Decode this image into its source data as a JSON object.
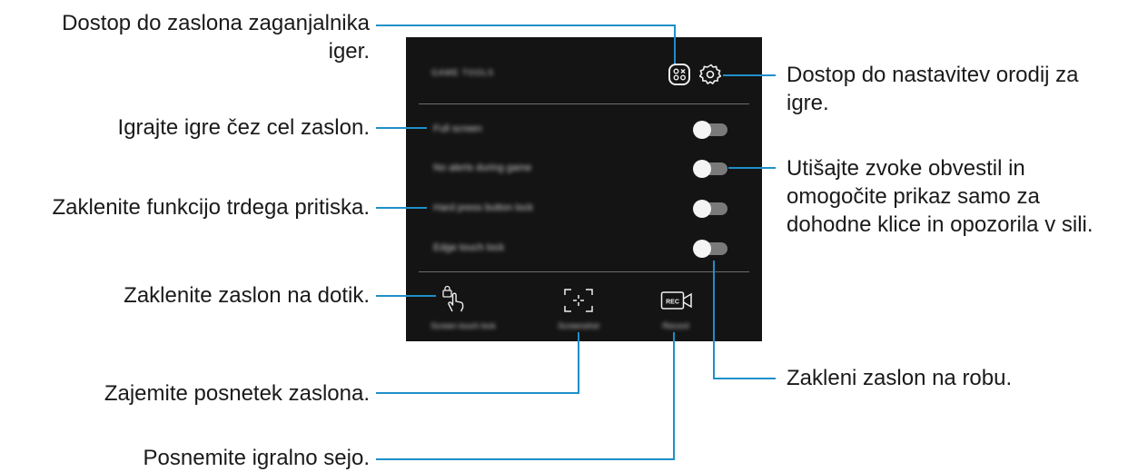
{
  "phone": {
    "title": "GAME TOOLS",
    "rows": [
      {
        "label": "Full screen"
      },
      {
        "label": "No alerts during game"
      },
      {
        "label": "Hard press button lock"
      },
      {
        "label": "Edge touch lock"
      }
    ],
    "tools": [
      {
        "label": "Screen touch lock"
      },
      {
        "label": "Screenshot"
      },
      {
        "label": "Record"
      }
    ]
  },
  "callouts": {
    "launcher": [
      "Dostop do zaslona zaganjalnika",
      "iger."
    ],
    "settings": [
      "Dostop do nastavitev orodij za",
      "igre."
    ],
    "full_screen": "Igrajte igre čez cel zaslon.",
    "no_alerts": [
      "Utišajte zvoke obvestil in",
      "omogočite prikaz samo za",
      "dohodne klice in opozorila v sili."
    ],
    "hard_press": "Zaklenite funkcijo trdega pritiska.",
    "touch_lock": "Zaklenite zaslon na dotik.",
    "edge_lock": "Zakleni zaslon na robu.",
    "screenshot": "Zajemite posnetek zaslona.",
    "record": "Posnemite igralno sejo."
  },
  "colors": {
    "leader": "#1e8fc9",
    "panel": "#141414"
  }
}
